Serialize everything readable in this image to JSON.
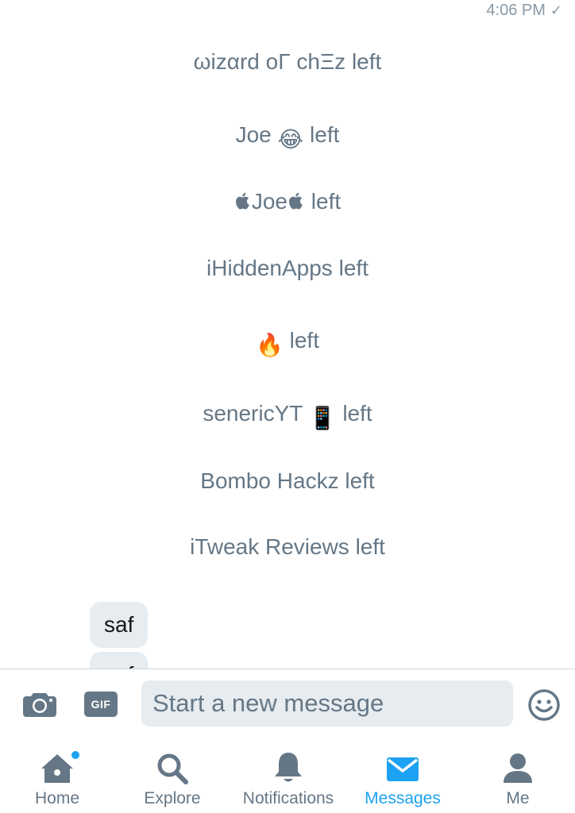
{
  "header": {
    "timestamp": "4:06 PM",
    "status": "✓"
  },
  "events": [
    {
      "name": "ωizαrd oΓ chΞz",
      "suffix": "left"
    },
    {
      "name": "Joe",
      "emoji": "😂",
      "suffix": "left"
    },
    {
      "name": "Joe",
      "prefix_icon": "apple-icon",
      "suffix_icon": "apple-icon",
      "suffix": "left"
    },
    {
      "name": "iHiddenApps",
      "suffix": "left"
    },
    {
      "emoji": "🔥",
      "suffix": "left"
    },
    {
      "name": "senericYT",
      "emoji": "📱",
      "suffix": "left"
    },
    {
      "name": "Bombo Hackz",
      "suffix": "left"
    },
    {
      "name": "iTweak Reviews",
      "suffix": "left"
    }
  ],
  "messages": [
    {
      "text": "saf"
    },
    {
      "text": "saf"
    }
  ],
  "composer": {
    "placeholder": "Start a new message",
    "gif_label": "GIF"
  },
  "tabs": [
    {
      "label": "Home",
      "icon": "home-icon",
      "badge": true
    },
    {
      "label": "Explore",
      "icon": "search-icon"
    },
    {
      "label": "Notifications",
      "icon": "bell-icon"
    },
    {
      "label": "Messages",
      "icon": "envelope-icon",
      "active": true
    },
    {
      "label": "Me",
      "icon": "person-icon"
    }
  ],
  "colors": {
    "accent": "#1da1f2",
    "muted": "#657786",
    "bubble": "#e6ecf0"
  }
}
